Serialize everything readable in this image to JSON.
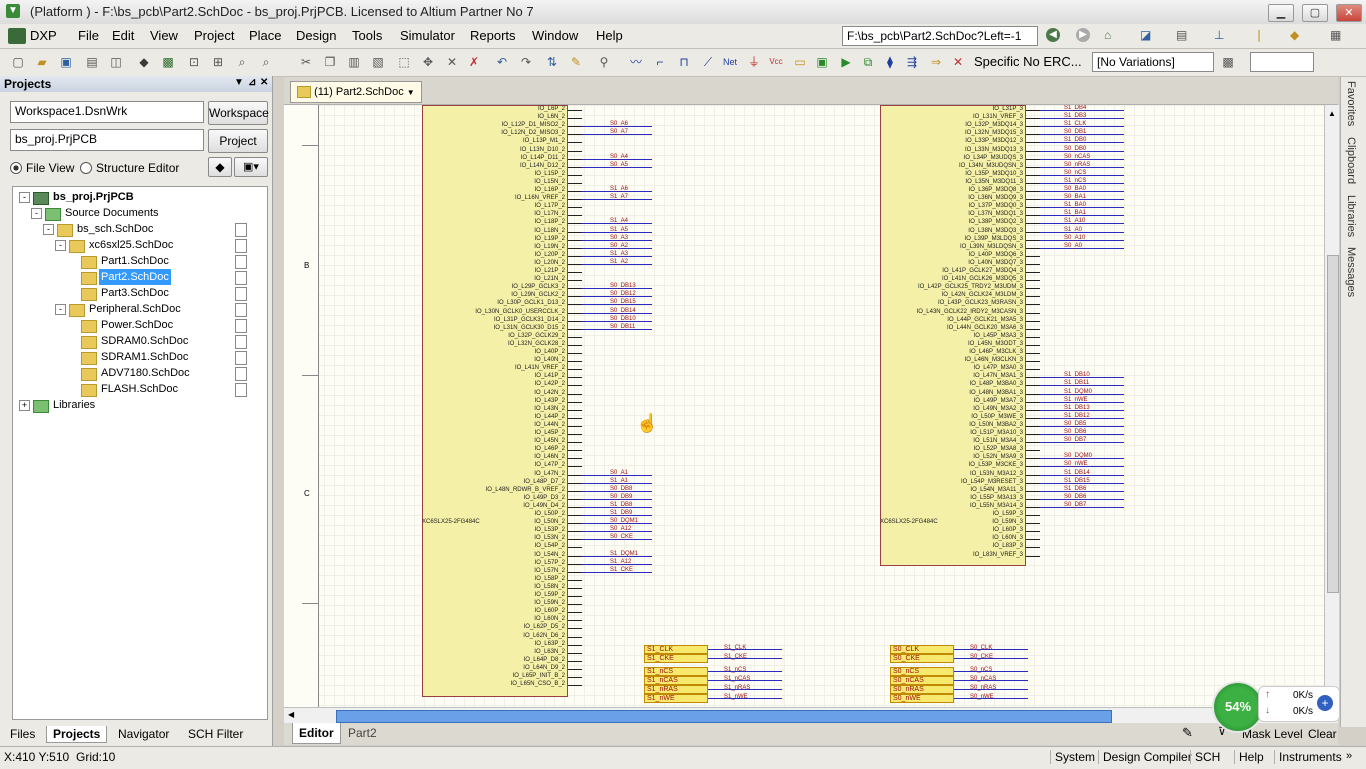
{
  "titlebar": {
    "title": "(Platform ) - F:\\bs_pcb\\Part2.SchDoc - bs_proj.PrjPCB. Licensed to Altium Partner No 7"
  },
  "menu": [
    "DXP",
    "File",
    "Edit",
    "View",
    "Project",
    "Place",
    "Design",
    "Tools",
    "Simulator",
    "Reports",
    "Window",
    "Help"
  ],
  "addressbar": {
    "value": "F:\\bs_pcb\\Part2.SchDoc?Left=-1"
  },
  "toolbar": {
    "erc_label": "Specific No ERC...",
    "variations": "[No Variations]"
  },
  "panel": {
    "title": "Projects",
    "workspace_combo": "Workspace1.DsnWrk",
    "workspace_button": "Workspace",
    "project_field": "bs_proj.PrjPCB",
    "project_button": "Project",
    "radio_file_view": "File View",
    "radio_structure": "Structure Editor",
    "tree": [
      {
        "label": "bs_proj.PrjPCB",
        "level": 0,
        "type": "project",
        "expander": "-"
      },
      {
        "label": "Source Documents",
        "level": 1,
        "type": "folder",
        "expander": "-"
      },
      {
        "label": "bs_sch.SchDoc",
        "level": 2,
        "type": "sheet",
        "expander": "-"
      },
      {
        "label": "xc6sxl25.SchDoc",
        "level": 3,
        "type": "sheet",
        "expander": "-"
      },
      {
        "label": "Part1.SchDoc",
        "level": 4,
        "type": "sheet",
        "expander": ""
      },
      {
        "label": "Part2.SchDoc",
        "level": 4,
        "type": "sheet",
        "expander": "",
        "selected": true
      },
      {
        "label": "Part3.SchDoc",
        "level": 4,
        "type": "sheet",
        "expander": ""
      },
      {
        "label": "Peripheral.SchDoc",
        "level": 3,
        "type": "sheet",
        "expander": "-"
      },
      {
        "label": "Power.SchDoc",
        "level": 4,
        "type": "sheet",
        "expander": ""
      },
      {
        "label": "SDRAM0.SchDoc",
        "level": 4,
        "type": "sheet",
        "expander": ""
      },
      {
        "label": "SDRAM1.SchDoc",
        "level": 4,
        "type": "sheet",
        "expander": ""
      },
      {
        "label": "ADV7180.SchDoc",
        "level": 4,
        "type": "sheet",
        "expander": ""
      },
      {
        "label": "FLASH.SchDoc",
        "level": 4,
        "type": "sheet",
        "expander": ""
      },
      {
        "label": "Libraries",
        "level": 0,
        "type": "folder",
        "expander": "+"
      }
    ],
    "bottom_tabs": [
      "Files",
      "Projects",
      "Navigator",
      "SCH Filter"
    ]
  },
  "document_tab": {
    "label": "(11) Part2.SchDoc"
  },
  "schematic": {
    "zones": [
      "B",
      "C"
    ],
    "chip_left_label": "XC6SLX25-2FG484C",
    "chip_right_label": "XC6SLX25-2FG484C",
    "left_pins": [
      "IO_L6P_2",
      "IO_L6N_2",
      "IO_L12P_D1_MISO2_2",
      "IO_L12N_D2_MISO3_2",
      "IO_L13P_M1_2",
      "IO_L13N_D10_2",
      "IO_L14P_D11_2",
      "IO_L14N_D12_2",
      "IO_L15P_2",
      "IO_L15N_2",
      "IO_L16P_2",
      "IO_L16N_VREF_2",
      "IO_L17P_2",
      "IO_L17N_2",
      "IO_L18P_2",
      "IO_L18N_2",
      "IO_L19P_2",
      "IO_L19N_2",
      "IO_L20P_2",
      "IO_L20N_2",
      "IO_L21P_2",
      "IO_L21N_2",
      "IO_L29P_GCLK3_2",
      "IO_L29N_GCLK2_2",
      "IO_L30P_GCLK1_D13_2",
      "IO_L30N_GCLK0_USERCCLK_2",
      "IO_L31P_GCLK31_D14_2",
      "IO_L31N_GCLK30_D15_2",
      "IO_L32P_GCLK29_2",
      "IO_L32N_GCLK28_2",
      "IO_L40P_2",
      "IO_L40N_2",
      "IO_L41N_VREF_2",
      "IO_L41P_2",
      "IO_L42P_2",
      "IO_L42N_2",
      "IO_L43P_2",
      "IO_L43N_2",
      "IO_L44P_2",
      "IO_L44N_2",
      "IO_L45P_2",
      "IO_L45N_2",
      "IO_L46P_2",
      "IO_L46N_2",
      "IO_L47P_2",
      "IO_L47N_2",
      "IO_L48P_D7_2",
      "IO_L48N_RDWR_B_VREF_2",
      "IO_L49P_D3_2",
      "IO_L49N_D4_2",
      "IO_L50P_2",
      "IO_L50N_2",
      "IO_L53P_2",
      "IO_L53N_2",
      "IO_L54P_2",
      "IO_L54N_2",
      "IO_L57P_2",
      "IO_L57N_2",
      "IO_L58P_2",
      "IO_L58N_2",
      "IO_L59P_2",
      "IO_L59N_2",
      "IO_L60P_2",
      "IO_L60N_2",
      "IO_L62P_D5_2",
      "IO_L62N_D6_2",
      "IO_L63P_2",
      "IO_L63N_2",
      "IO_L64P_D8_2",
      "IO_L64N_D9_2",
      "IO_L65P_INIT_B_2",
      "IO_L65N_CSO_B_2"
    ],
    "right_pins": [
      "IO_L31P_3",
      "IO_L31N_VREF_3",
      "IO_L32P_M3DQ14_3",
      "IO_L32N_M3DQ15_3",
      "IO_L33P_M3DQ12_3",
      "IO_L33N_M3DQ13_3",
      "IO_L34P_M3UDQS_3",
      "IO_L34N_M3UDQSN_3",
      "IO_L35P_M3DQ10_3",
      "IO_L35N_M3DQ11_3",
      "IO_L36P_M3DQ8_3",
      "IO_L36N_M3DQ9_3",
      "IO_L37P_M3DQ0_3",
      "IO_L37N_M3DQ1_3",
      "IO_L38P_M3DQ2_3",
      "IO_L38N_M3DQ3_3",
      "IO_L39P_M3LDQS_3",
      "IO_L39N_M3LDQSN_3",
      "IO_L40P_M3DQ6_3",
      "IO_L40N_M3DQ7_3",
      "IO_L41P_GCLK27_M3DQ4_3",
      "IO_L41N_GCLK26_M3DQ5_3",
      "IO_L42P_GCLK25_TRDY2_M3UDM_3",
      "IO_L42N_GCLK24_M3LDM_3",
      "IO_L43P_GCLK23_M3RASN_3",
      "IO_L43N_GCLK22_IRDY2_M3CASN_3",
      "IO_L44P_GCLK21_M3A5_3",
      "IO_L44N_GCLK20_M3A6_3",
      "IO_L45P_M3A3_3",
      "IO_L45N_M3ODT_3",
      "IO_L46P_M3CLK_3",
      "IO_L46N_M3CLKN_3",
      "IO_L47P_M3A0_3",
      "IO_L47N_M3A1_3",
      "IO_L48P_M3BA0_3",
      "IO_L48N_M3BA1_3",
      "IO_L49P_M3A7_3",
      "IO_L49N_M3A2_3",
      "IO_L50P_M3WE_3",
      "IO_L50N_M3BA2_3",
      "IO_L51P_M3A10_3",
      "IO_L51N_M3A4_3",
      "IO_L52P_M3A8_3",
      "IO_L52N_M3A9_3",
      "IO_L53P_M3CKE_3",
      "IO_L53N_M3A12_3",
      "IO_L54P_M3RESET_3",
      "IO_L54N_M3A11_3",
      "IO_L55P_M3A13_3",
      "IO_L55N_M3A14_3",
      "IO_L59P_3",
      "IO_L59N_3",
      "IO_L60P_3",
      "IO_L60N_3",
      "IO_L83P_3",
      "IO_L83N_VREF_3"
    ],
    "left_nets": [
      {
        "row": 2,
        "label": "S0_A6"
      },
      {
        "row": 3,
        "label": "S0_A7"
      },
      {
        "row": 6,
        "label": "S0_A4"
      },
      {
        "row": 7,
        "label": "S0_A5"
      },
      {
        "row": 10,
        "label": "S1_A6"
      },
      {
        "row": 11,
        "label": "S1_A7"
      },
      {
        "row": 14,
        "label": "S1_A4"
      },
      {
        "row": 15,
        "label": "S1_A5"
      },
      {
        "row": 16,
        "label": "S0_A3"
      },
      {
        "row": 17,
        "label": "S0_A2"
      },
      {
        "row": 18,
        "label": "S1_A3"
      },
      {
        "row": 19,
        "label": "S1_A2"
      },
      {
        "row": 22,
        "label": "S0_DB13"
      },
      {
        "row": 23,
        "label": "S0_DB12"
      },
      {
        "row": 24,
        "label": "S0_DB15"
      },
      {
        "row": 25,
        "label": "S0_DB14"
      },
      {
        "row": 26,
        "label": "S0_DB10"
      },
      {
        "row": 27,
        "label": "S0_DB11"
      },
      {
        "row": 45,
        "label": "S0_A1"
      },
      {
        "row": 46,
        "label": "S1_A1"
      },
      {
        "row": 47,
        "label": "S0_DB8"
      },
      {
        "row": 48,
        "label": "S0_DB9"
      },
      {
        "row": 49,
        "label": "S1_DB8"
      },
      {
        "row": 50,
        "label": "S1_DB9"
      },
      {
        "row": 51,
        "label": "S0_DQM1"
      },
      {
        "row": 52,
        "label": "S0_A12"
      },
      {
        "row": 53,
        "label": "S0_CKE"
      },
      {
        "row": 55,
        "label": "S1_DQM1"
      },
      {
        "row": 56,
        "label": "S1_A12"
      },
      {
        "row": 57,
        "label": "S1_CKE"
      }
    ],
    "right_nets": [
      {
        "row": 0,
        "label": "S1_DB4"
      },
      {
        "row": 1,
        "label": "S1_DB3"
      },
      {
        "row": 2,
        "label": "S1_CLK"
      },
      {
        "row": 3,
        "label": "S0_DB1"
      },
      {
        "row": 4,
        "label": "S1_DB0"
      },
      {
        "row": 5,
        "label": "S0_DB0"
      },
      {
        "row": 6,
        "label": "S0_nCAS"
      },
      {
        "row": 7,
        "label": "S0_nRAS"
      },
      {
        "row": 8,
        "label": "S0_nCS"
      },
      {
        "row": 9,
        "label": "S1_nCS"
      },
      {
        "row": 10,
        "label": "S0_BA0"
      },
      {
        "row": 11,
        "label": "S0_BA1"
      },
      {
        "row": 12,
        "label": "S1_BA0"
      },
      {
        "row": 13,
        "label": "S1_BA1"
      },
      {
        "row": 14,
        "label": "S1_A10"
      },
      {
        "row": 15,
        "label": "S1_A0"
      },
      {
        "row": 16,
        "label": "S0_A10"
      },
      {
        "row": 17,
        "label": "S0_A0"
      },
      {
        "row": 33,
        "label": "S1_DB10"
      },
      {
        "row": 34,
        "label": "S1_DB11"
      },
      {
        "row": 35,
        "label": "S1_DQM0"
      },
      {
        "row": 36,
        "label": "S1_nWE"
      },
      {
        "row": 37,
        "label": "S1_DB13"
      },
      {
        "row": 38,
        "label": "S1_DB12"
      },
      {
        "row": 39,
        "label": "S0_DB5"
      },
      {
        "row": 40,
        "label": "S0_DB6"
      },
      {
        "row": 41,
        "label": "S0_DB7"
      },
      {
        "row": 43,
        "label": "S0_DQM0"
      },
      {
        "row": 44,
        "label": "S0_nWE"
      },
      {
        "row": 45,
        "label": "S1_DB14"
      },
      {
        "row": 46,
        "label": "S1_DB15"
      },
      {
        "row": 47,
        "label": "S1_DB6"
      },
      {
        "row": 48,
        "label": "S0_DB6"
      },
      {
        "row": 49,
        "label": "S0_DB7"
      }
    ],
    "connector_groups": [
      {
        "top": [
          "S1_CLK",
          "S1_CKE"
        ],
        "bottom": [
          "S1_nCS",
          "S1_nCAS",
          "S1_nRAS",
          "S1_nWE"
        ]
      },
      {
        "top": [
          "S0_CLK",
          "S0_CKE"
        ],
        "bottom": [
          "S0_nCS",
          "S0_nCAS",
          "S0_nRAS",
          "S0_nWE"
        ]
      }
    ]
  },
  "right_strip": [
    "Favorites",
    "Clipboard",
    "Libraries",
    "Messages"
  ],
  "editor_tabs": [
    "Editor",
    "Part2"
  ],
  "network": {
    "cpu_percent": "54%",
    "up_rate": "0K/s",
    "down_rate": "0K/s"
  },
  "mask": {
    "label": "Mask Level",
    "clear": "Clear"
  },
  "status": {
    "coords": "X:410 Y:510",
    "grid": "Grid:10",
    "buttons": [
      "System",
      "Design Compiler",
      "SCH",
      "Help",
      "Instruments"
    ]
  }
}
